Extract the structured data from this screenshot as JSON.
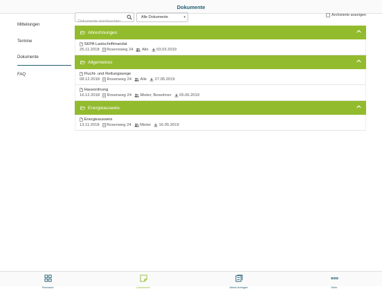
{
  "header": {
    "title": "Dokumente"
  },
  "sidebar": {
    "items": [
      {
        "label": "Mitteilungen"
      },
      {
        "label": "Termine"
      },
      {
        "label": "Dokumente"
      },
      {
        "label": "FAQ"
      }
    ]
  },
  "toolbar": {
    "search_placeholder": "Dokumente durchsuchen",
    "search_value": "",
    "filter_selected": "Alle Dokumente",
    "archived_label": "Archivierte anzeigen"
  },
  "groups": [
    {
      "title": "Abrechnungen",
      "docs": [
        {
          "name": "SEPA Lastschriftmandat",
          "date": "25.11.2018",
          "building": "Rosensweg 24",
          "audience": "Alle",
          "download": "03.03.2019"
        }
      ]
    },
    {
      "title": "Allgemeines",
      "docs": [
        {
          "name": "Flucht- und Rettungswege",
          "date": "08.12.2018",
          "building": "Rosenweg 24",
          "audience": "Alle",
          "download": "27.05.2019"
        },
        {
          "name": "Hausordnung",
          "date": "16.12.2018",
          "building": "Rosenweg 24",
          "audience": "Mieter, Bewohner",
          "download": "05.06.2019"
        }
      ]
    },
    {
      "title": "Energieausweis",
      "docs": [
        {
          "name": "Energieausweis",
          "date": "13.11.2018",
          "building": "Rosenweg 24",
          "audience": "Mieter",
          "download": "16.05.2019"
        }
      ]
    }
  ],
  "tabbar": {
    "items": [
      {
        "label": "Pinnwand"
      },
      {
        "label": "Dokumente"
      },
      {
        "label": "Meine Anfragen"
      },
      {
        "label": "Mehr"
      }
    ]
  },
  "colors": {
    "accent": "#93bb2e",
    "primary": "#1f5c73"
  }
}
